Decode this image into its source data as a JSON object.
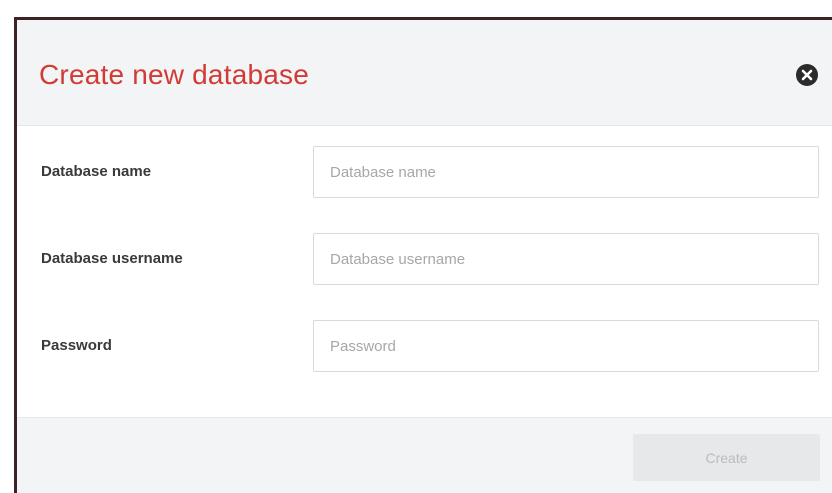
{
  "dialog": {
    "title": "Create new database",
    "close_icon": "close-circle-icon"
  },
  "form": {
    "fields": [
      {
        "label": "Database name",
        "placeholder": "Database name",
        "value": ""
      },
      {
        "label": "Database username",
        "placeholder": "Database username",
        "value": ""
      },
      {
        "label": "Password",
        "placeholder": "Password",
        "value": ""
      }
    ]
  },
  "footer": {
    "create_label": "Create",
    "create_disabled": true
  },
  "colors": {
    "title": "#d23b35",
    "header_bg": "#f2f4f5",
    "close_icon": "#2b2b2b",
    "button_bg_disabled": "#e6e8e9"
  }
}
